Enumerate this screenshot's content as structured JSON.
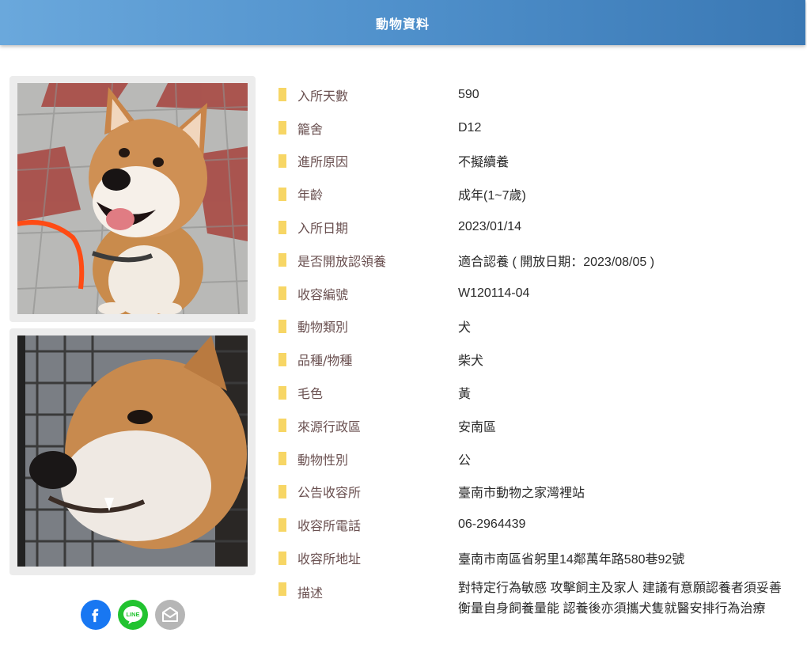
{
  "header": {
    "title": "動物資料"
  },
  "share": {
    "facebook_icon": "facebook-icon",
    "line_icon": "line-icon",
    "line_text": "LINE",
    "mail_icon": "mail-icon"
  },
  "colors": {
    "header_start": "#6aa8dc",
    "header_end": "#3a78b4",
    "marker": "#f7d665",
    "label": "#6a5050",
    "facebook": "#1877f2",
    "line": "#22c330",
    "mail": "#b6b6b6"
  },
  "details": [
    {
      "label": "入所天數",
      "value": "590"
    },
    {
      "label": "籠舍",
      "value": "D12"
    },
    {
      "label": "進所原因",
      "value": "不擬續養"
    },
    {
      "label": "年齡",
      "value": "成年(1~7歲)"
    },
    {
      "label": "入所日期",
      "value": "2023/01/14"
    },
    {
      "label": "是否開放認領養",
      "value": "適合認養 ( 開放日期：2023/08/05 )"
    },
    {
      "label": "收容編號",
      "value": "W120114-04"
    },
    {
      "label": "動物類別",
      "value": "犬"
    },
    {
      "label": "品種/物種",
      "value": "柴犬"
    },
    {
      "label": "毛色",
      "value": "黃"
    },
    {
      "label": "來源行政區",
      "value": "安南區"
    },
    {
      "label": "動物性別",
      "value": "公"
    },
    {
      "label": "公告收容所",
      "value": "臺南市動物之家灣裡站"
    },
    {
      "label": "收容所電話",
      "value": "06-2964439"
    },
    {
      "label": "收容所地址",
      "value": "臺南市南區省躬里14鄰萬年路580巷92號"
    },
    {
      "label": "描述",
      "value": "對特定行為敏感 攻擊飼主及家人 建議有意願認養者須妥善衡量自身飼養量能 認養後亦須攜犬隻就醫安排行為治療"
    }
  ]
}
